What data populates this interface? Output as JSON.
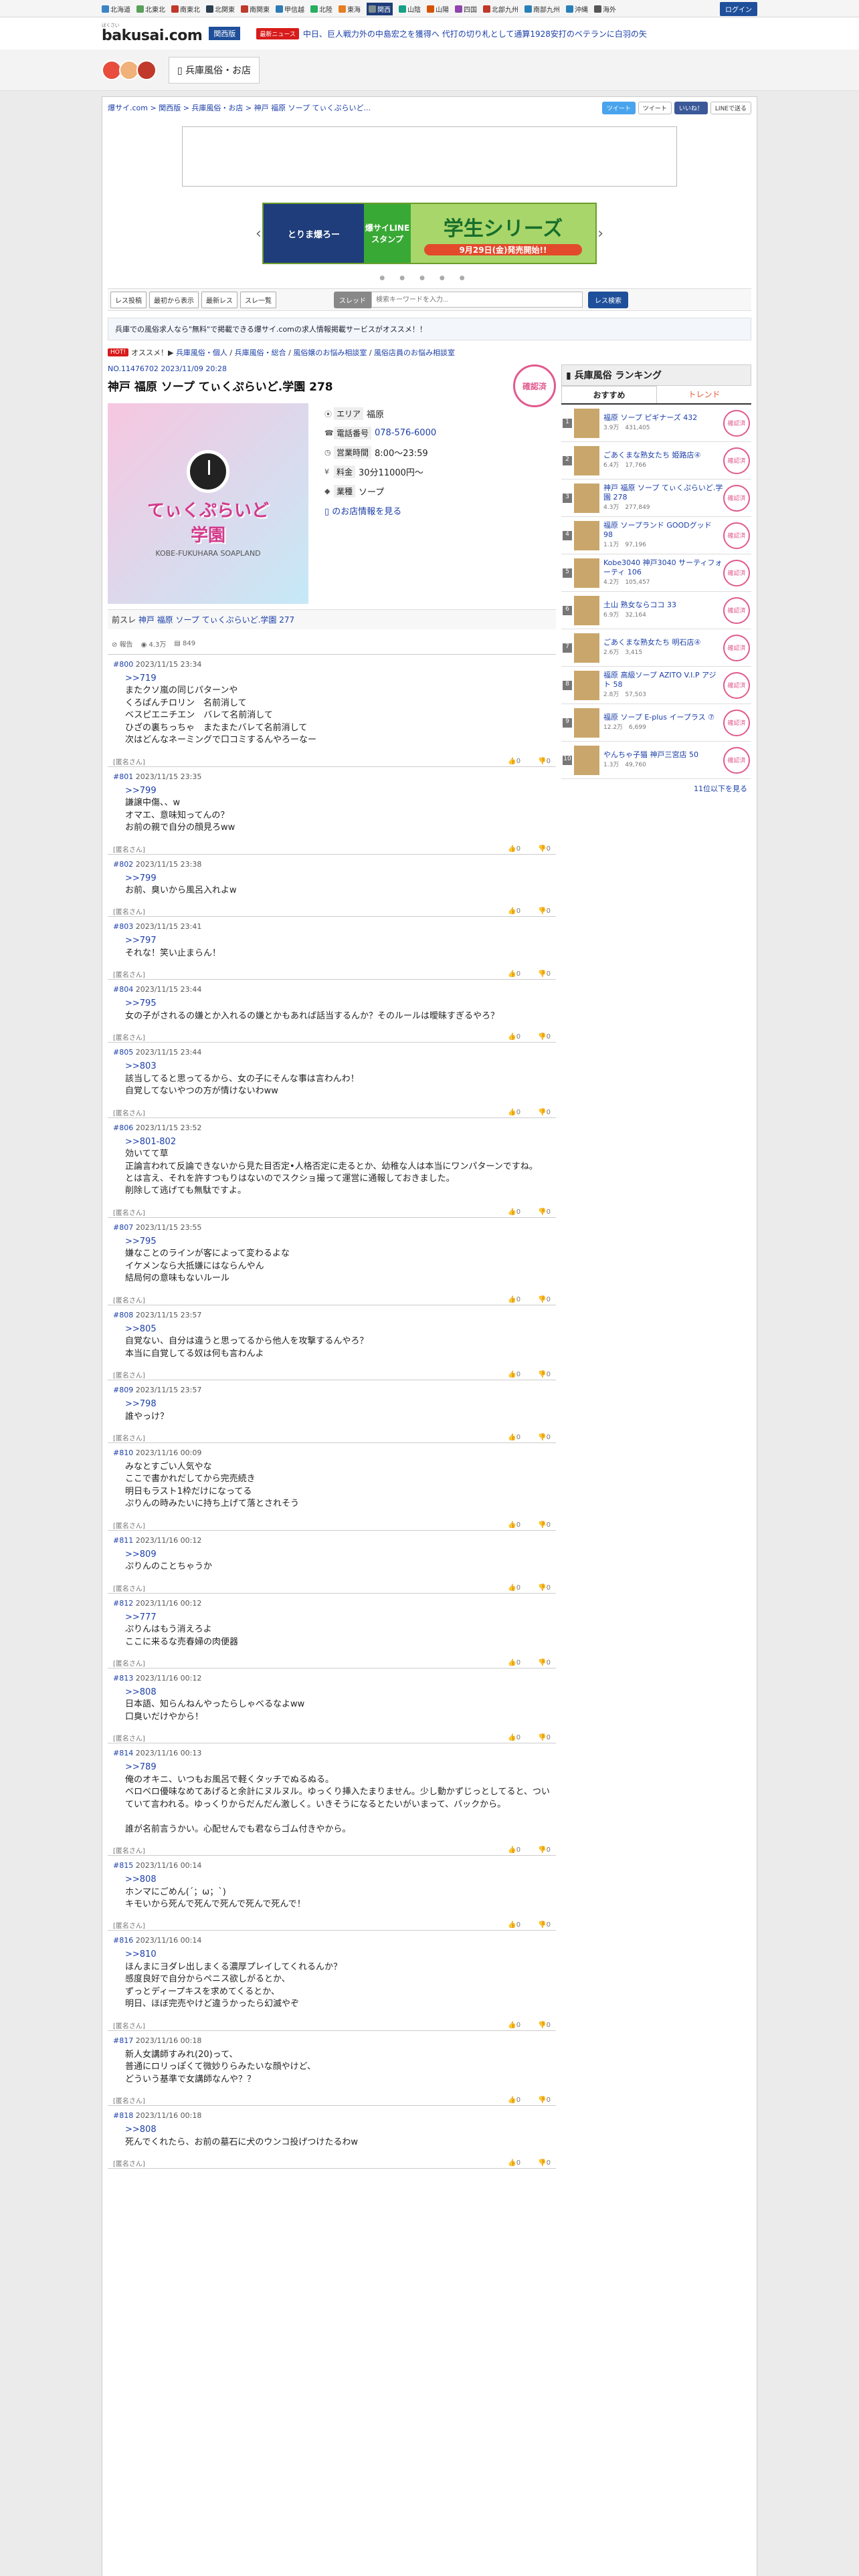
{
  "regions": [
    {
      "label": "北海道",
      "color": "#3d84c6"
    },
    {
      "label": "北東北",
      "color": "#5aa05a"
    },
    {
      "label": "南東北",
      "color": "#c0392b"
    },
    {
      "label": "北関東",
      "color": "#2c3e50"
    },
    {
      "label": "南関東",
      "color": "#c0392b"
    },
    {
      "label": "甲信越",
      "color": "#2c7bb6"
    },
    {
      "label": "北陸",
      "color": "#27ae60"
    },
    {
      "label": "東海",
      "color": "#e67e22"
    },
    {
      "label": "関西",
      "color": "#7f8c8d",
      "active": true
    },
    {
      "label": "山陰",
      "color": "#16a085"
    },
    {
      "label": "山陽",
      "color": "#d35400"
    },
    {
      "label": "四国",
      "color": "#8e44ad"
    },
    {
      "label": "北部九州",
      "color": "#c0392b"
    },
    {
      "label": "南部九州",
      "color": "#2980b9"
    },
    {
      "label": "沖縄",
      "color": "#2980b9"
    },
    {
      "label": "海外",
      "color": "#555555"
    }
  ],
  "header": {
    "login": "ログイン",
    "logo_small": "ばくさい",
    "logo": "bakusai.com",
    "region": "関西版",
    "news_badge": "最新ニュース",
    "news_text": "中日、巨人戦力外の中島宏之を獲得へ 代打の切り札として通算1928安打のベテランに白羽の矢"
  },
  "category_tab": "兵庫風俗・お店",
  "breadcrumb": "爆サイ.com > 関西版 > 兵庫風俗・お店 > 神戸 福原 ソープ てぃくぷらいど...",
  "share": {
    "twitter": "ツイート",
    "tweet": "ツイート",
    "like": "いいね！",
    "line": "LINEで送る"
  },
  "banner": {
    "left": "とりま爆ろー",
    "mid": "爆サイLINEスタンプ",
    "main": "学生シリーズ",
    "date": "9月29日(金)発売開始!!"
  },
  "toolbar": {
    "b1": "レス投稿",
    "b2": "最初から表示",
    "b3": "最新レス",
    "b4": "スレ一覧",
    "select": "スレッド",
    "keyword_placeholder": "検索キーワードを入力...",
    "search": "レス検索"
  },
  "promo": "兵庫での風俗求人なら\"無料\"で掲載できる爆サイ.comの求人情報掲載サービスがオススメ！！",
  "hot": {
    "badge": "HOT!",
    "label": "オススメ！",
    "links": [
      "兵庫風俗・個人",
      "兵庫風俗・総合",
      "風俗嬢のお悩み相談室",
      "風俗店員のお悩み相談室"
    ]
  },
  "thread": {
    "id": "NO.11476702 2023/11/09 20:28",
    "title": "神戸 福原 ソープ てぃくぷらいど.学園 278",
    "stamp": "確認済"
  },
  "shop": {
    "img_title": "てぃくぷらいど",
    "img_title2": "学園",
    "img_sub": "KOBE-FUKUHARA SOAPLAND",
    "area_label": "エリア",
    "area": "福原",
    "tel_label": "電話番号",
    "tel": "078-576-6000",
    "hours_label": "営業時間",
    "hours": "8:00〜23:59",
    "fee_label": "料金",
    "fee": "30分11000円〜",
    "type_label": "業種",
    "type": "ソープ",
    "more": "のお店情報を見る"
  },
  "prev": {
    "label": "前スレ",
    "title": "神戸 福原 ソープ てぃくぷらいど.学園 277"
  },
  "stats": {
    "report": "報告",
    "views": "4.3万",
    "res": "849"
  },
  "posts": [
    {
      "no": "#800",
      "date": "2023/11/15 23:34",
      "anchor": ">>719",
      "body": "またクソ嵐の同じパターンや\nくろぱんチロリン　名前消して\nベスピエニチエン　バレて名前消して\nひざの裏ちっちゃ　またまたバレて名前消して\n次はどんなネーミングで口コミするんやろーなー",
      "name": "[匿名さん]"
    },
    {
      "no": "#801",
      "date": "2023/11/15 23:35",
      "anchor": ">>799",
      "body": "謙譲中傷、、w\nオマエ、意味知ってんの？\nお前の親で自分の顔見ろww",
      "name": "[匿名さん]"
    },
    {
      "no": "#802",
      "date": "2023/11/15 23:38",
      "anchor": ">>799",
      "body": "お前、臭いから風呂入れよw",
      "name": "[匿名さん]"
    },
    {
      "no": "#803",
      "date": "2023/11/15 23:41",
      "anchor": ">>797",
      "body": "それな！笑い止まらん！",
      "name": "[匿名さん]"
    },
    {
      "no": "#804",
      "date": "2023/11/15 23:44",
      "anchor": ">>795",
      "body": "女の子がされるの嫌とか入れるの嫌とかもあれば話当するんか？そのルールは曖昧すぎるやろ？",
      "name": "[匿名さん]"
    },
    {
      "no": "#805",
      "date": "2023/11/15 23:44",
      "anchor": ">>803",
      "body": "該当してると思ってるから、女の子にそんな事は言わんわ！\n自覚してないやつの方が情けないわww",
      "name": "[匿名さん]"
    },
    {
      "no": "#806",
      "date": "2023/11/15 23:52",
      "anchor": ">>801-802",
      "body": "効いてて草\n正論言われて反論できないから見た目否定•人格否定に走るとか、幼稚な人は本当にワンパターンですね。\nとは言え、それを許すつもりはないのでスクショ撮って運営に通報しておきました。\n削除して逃げても無駄ですよ。",
      "name": "[匿名さん]"
    },
    {
      "no": "#807",
      "date": "2023/11/15 23:55",
      "anchor": ">>795",
      "body": "嫌なことのラインが客によって変わるよな\nイケメンなら大抵嫌にはならんやん\n結局何の意味もないルール",
      "name": "[匿名さん]"
    },
    {
      "no": "#808",
      "date": "2023/11/15 23:57",
      "anchor": ">>805",
      "body": "自覚ない、自分は違うと思ってるから他人を攻撃するんやろ？\n本当に自覚してる奴は何も言わんよ",
      "name": "[匿名さん]"
    },
    {
      "no": "#809",
      "date": "2023/11/15 23:57",
      "anchor": ">>798",
      "body": "誰やっけ？",
      "name": "[匿名さん]"
    },
    {
      "no": "#810",
      "date": "2023/11/16 00:09",
      "anchor": "",
      "body": "みなとすごい人気やな\nここで書かれだしてから完売続き\n明日もラスト1枠だけになってる\nぷりんの時みたいに持ち上げて落とされそう",
      "name": "[匿名さん]"
    },
    {
      "no": "#811",
      "date": "2023/11/16 00:12",
      "anchor": ">>809",
      "body": "ぷりんのことちゃうか",
      "name": "[匿名さん]"
    },
    {
      "no": "#812",
      "date": "2023/11/16 00:12",
      "anchor": ">>777",
      "body": "ぷりんはもう消えろよ\nここに来るな売春婦の肉便器",
      "name": "[匿名さん]"
    },
    {
      "no": "#813",
      "date": "2023/11/16 00:12",
      "anchor": ">>808",
      "body": "日本語、知らんねんやったらしゃべるなよww\n口臭いだけやから！",
      "name": "[匿名さん]"
    },
    {
      "no": "#814",
      "date": "2023/11/16 00:13",
      "anchor": ">>789",
      "body": "俺のオキニ、いつもお風呂で軽くタッチでぬるぬる。\nベロベロ優味なめてあげると余計にヌルヌル。ゆっくり挿入たまりません。少し動かずじっとしてると、ついていて言われる。ゆっくりからだんだん激しく。いきそうになるとたいがいまって、バックから。\n\n誰が名前言うかい。心配せんでも君ならゴム付きやから。",
      "name": "[匿名さん]"
    },
    {
      "no": "#815",
      "date": "2023/11/16 00:14",
      "anchor": ">>808",
      "body": "ホンマにごめん(´；ω；`)\nキモいから死んで死んで死んで死んで死んで！",
      "name": "[匿名さん]"
    },
    {
      "no": "#816",
      "date": "2023/11/16 00:14",
      "anchor": ">>810",
      "body": "ほんまにヨダレ出しまくる濃厚プレイしてくれるんか？\n感度良好で自分からペニス欲しがるとか、\nずっとディープキスを求めてくるとか、\n明日、ほぼ完売やけど違うかったら幻滅やぞ",
      "name": "[匿名さん]"
    },
    {
      "no": "#817",
      "date": "2023/11/16 00:18",
      "anchor": "",
      "body": "新人女講師すみれ(20)って、\n普通にロリっぽくて微妙りらみたいな顔やけど、\nどういう基準で女講師なんや？？",
      "name": "[匿名さん]"
    },
    {
      "no": "#818",
      "date": "2023/11/16 00:18",
      "anchor": ">>808",
      "body": "死んでくれたら、お前の墓石に犬のウンコ投げつけたるわw",
      "name": "[匿名さん]"
    }
  ],
  "vote_labels": {
    "up": "0",
    "down": "0"
  },
  "ranking": {
    "title": "兵庫風俗 ランキング",
    "tab1": "おすすめ",
    "tab2": "トレンド",
    "badge": "確認済",
    "more": "11位以下を見る",
    "items": [
      {
        "no": "1",
        "title": "福原 ソープ ピギナーズ 432",
        "meta": "3.9万　431,405"
      },
      {
        "no": "2",
        "title": "ごあくまな熟女たち 姫路店④",
        "meta": "6.4万　17,766"
      },
      {
        "no": "3",
        "title": "神戸 福原 ソープ てぃくぷらいど.学園 278",
        "meta": "4.3万　277,849"
      },
      {
        "no": "4",
        "title": "福原 ソープランド GOODグッド 98",
        "meta": "1.1万　97,196"
      },
      {
        "no": "5",
        "title": "Kobe3040 神戸3040 サーティフォーティ 106",
        "meta": "4.2万　105,457"
      },
      {
        "no": "6",
        "title": "土山 熟女ならココ 33",
        "meta": "6.9万　32,164"
      },
      {
        "no": "7",
        "title": "ごあくまな熟女たち 明石店④",
        "meta": "2.6万　3,415"
      },
      {
        "no": "8",
        "title": "福原 高級ソープ AZITO V.I.P アジト 58",
        "meta": "2.8万　57,503"
      },
      {
        "no": "9",
        "title": "福原 ソープ E-plus イープラス ⑦",
        "meta": "12.2万　6,699"
      },
      {
        "no": "10",
        "title": "やんちゃ子猫 神戸三宮店 50",
        "meta": "1.3万　49,760"
      }
    ]
  }
}
